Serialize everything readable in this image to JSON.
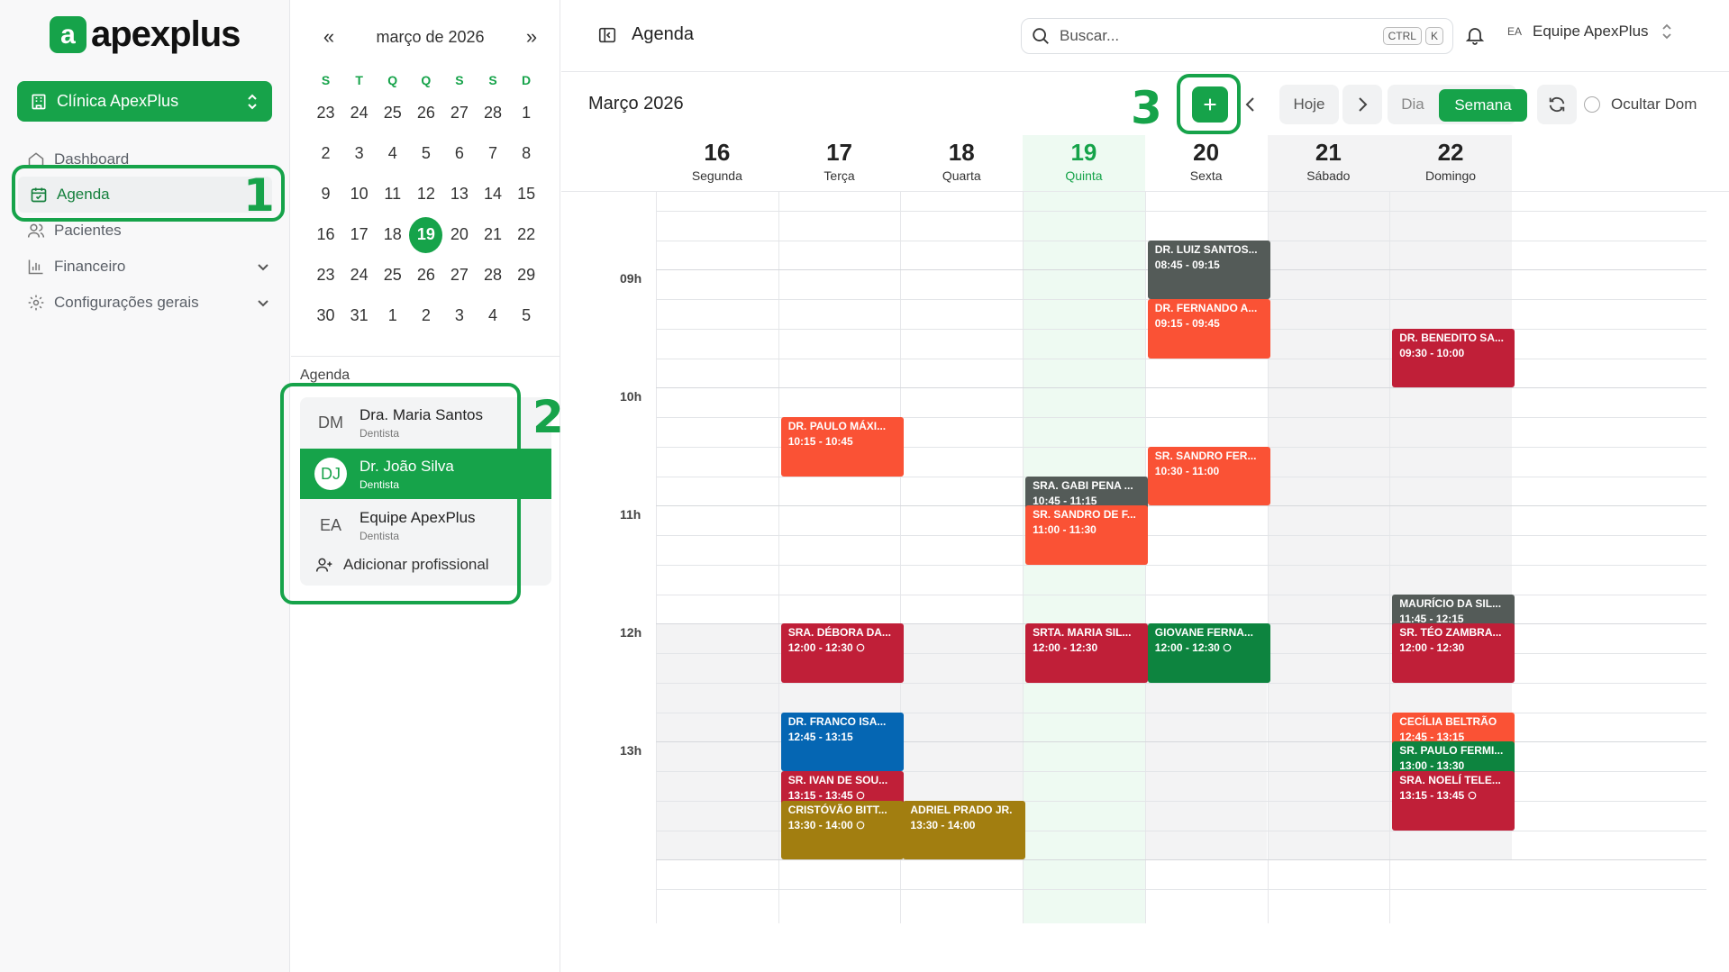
{
  "sidebar": {
    "logo_mark": "a",
    "logo_text": "apexplus",
    "clinic": "Clínica ApexPlus",
    "nav": [
      {
        "label": "Dashboard"
      },
      {
        "label": "Agenda"
      },
      {
        "label": "Pacientes"
      },
      {
        "label": "Financeiro"
      },
      {
        "label": "Configurações gerais"
      }
    ]
  },
  "annotations": {
    "one": "1",
    "two": "2",
    "three": "3"
  },
  "calendar": {
    "month": "março de 2026",
    "prev": "«",
    "next": "»",
    "weekdays": [
      "S",
      "T",
      "Q",
      "Q",
      "S",
      "S",
      "D"
    ],
    "weeks": [
      [
        "23",
        "24",
        "25",
        "26",
        "27",
        "28",
        "1"
      ],
      [
        "2",
        "3",
        "4",
        "5",
        "6",
        "7",
        "8"
      ],
      [
        "9",
        "10",
        "11",
        "12",
        "13",
        "14",
        "15"
      ],
      [
        "16",
        "17",
        "18",
        "19",
        "20",
        "21",
        "22"
      ],
      [
        "23",
        "24",
        "25",
        "26",
        "27",
        "28",
        "29"
      ],
      [
        "30",
        "31",
        "1",
        "2",
        "3",
        "4",
        "5"
      ]
    ],
    "selected": "19"
  },
  "agenda_section": {
    "label": "Agenda",
    "professionals": [
      {
        "initials": "DM",
        "name": "Dra. Maria Santos",
        "role": "Dentista",
        "active": false
      },
      {
        "initials": "DJ",
        "name": "Dr. João Silva",
        "role": "Dentista",
        "active": true
      },
      {
        "initials": "EA",
        "name": "Equipe ApexPlus",
        "role": "Dentista",
        "active": false
      }
    ],
    "add_label": "Adicionar profissional"
  },
  "topbar": {
    "title": "Agenda",
    "search_placeholder": "Buscar...",
    "kbd1": "CTRL",
    "kbd2": "K",
    "user_initials": "EA",
    "user_name": "Equipe ApexPlus"
  },
  "toolbar": {
    "month_title": "Março 2026",
    "today": "Hoje",
    "day": "Dia",
    "week": "Semana",
    "hide_sunday": "Ocultar Dom"
  },
  "week": {
    "days": [
      {
        "num": "16",
        "name": "Segunda",
        "today": false,
        "shaded": false
      },
      {
        "num": "17",
        "name": "Terça",
        "today": false,
        "shaded": false
      },
      {
        "num": "18",
        "name": "Quarta",
        "today": false,
        "shaded": false
      },
      {
        "num": "19",
        "name": "Quinta",
        "today": true,
        "shaded": false
      },
      {
        "num": "20",
        "name": "Sexta",
        "today": false,
        "shaded": false
      },
      {
        "num": "21",
        "name": "Sábado",
        "today": false,
        "shaded": true
      },
      {
        "num": "22",
        "name": "Domingo",
        "today": false,
        "shaded": true
      }
    ],
    "hours": [
      "09h",
      "10h",
      "11h",
      "12h",
      "13h"
    ]
  },
  "colors": {
    "accent": "#16a34a",
    "today_col": "#eefaf2",
    "weekend_col": "#f3f3f4",
    "gray": "#545b58",
    "orange": "#fa5235",
    "crimson": "#c01f38",
    "green": "#0d843f",
    "blue": "#0566b3",
    "olive": "#a27e10"
  },
  "events": [
    {
      "day": 4,
      "start": "08:45",
      "end": "09:15",
      "name": "DR. LUIZ SANTOS...",
      "time": "08:45 - 09:15",
      "color": "gray",
      "chat": false
    },
    {
      "day": 4,
      "start": "09:15",
      "end": "09:45",
      "name": "DR. FERNANDO A...",
      "time": "09:15 - 09:45",
      "color": "orange",
      "chat": false
    },
    {
      "day": 6,
      "start": "09:30",
      "end": "10:00",
      "name": "DR. BENEDITO SA...",
      "time": "09:30 - 10:00",
      "color": "crimson",
      "chat": false
    },
    {
      "day": 1,
      "start": "10:15",
      "end": "10:45",
      "name": "DR. PAULO MÁXI...",
      "time": "10:15 - 10:45",
      "color": "orange",
      "chat": false
    },
    {
      "day": 4,
      "start": "10:30",
      "end": "11:00",
      "name": "SR. SANDRO FER...",
      "time": "10:30 - 11:00",
      "color": "orange",
      "chat": false
    },
    {
      "day": 3,
      "start": "10:45",
      "end": "11:15",
      "name": "SRA. GABI PENA ...",
      "time": "10:45 - 11:15",
      "color": "gray",
      "chat": false
    },
    {
      "day": 3,
      "start": "11:00",
      "end": "11:30",
      "name": "SR. SANDRO DE F...",
      "time": "11:00 - 11:30",
      "color": "orange",
      "chat": false
    },
    {
      "day": 6,
      "start": "11:45",
      "end": "12:15",
      "name": "MAURÍCIO DA SIL...",
      "time": "11:45 - 12:15",
      "color": "gray",
      "chat": false
    },
    {
      "day": 1,
      "start": "12:00",
      "end": "12:30",
      "name": "SRA. DÉBORA DA...",
      "time": "12:00 - 12:30",
      "color": "crimson",
      "chat": true
    },
    {
      "day": 3,
      "start": "12:00",
      "end": "12:30",
      "name": "SRTA. MARIA SIL...",
      "time": "12:00 - 12:30",
      "color": "crimson",
      "chat": false
    },
    {
      "day": 4,
      "start": "12:00",
      "end": "12:30",
      "name": "GIOVANE FERNA...",
      "time": "12:00 - 12:30",
      "color": "green",
      "chat": true
    },
    {
      "day": 6,
      "start": "12:00",
      "end": "12:30",
      "name": "SR. TÉO ZAMBRA...",
      "time": "12:00 - 12:30",
      "color": "crimson",
      "chat": false
    },
    {
      "day": 1,
      "start": "12:45",
      "end": "13:15",
      "name": "DR. FRANCO ISA...",
      "time": "12:45 - 13:15",
      "color": "blue",
      "chat": false
    },
    {
      "day": 6,
      "start": "12:45",
      "end": "13:15",
      "name": "CECÍLIA BELTRÃO",
      "time": "12:45 - 13:15",
      "color": "orange",
      "chat": false
    },
    {
      "day": 1,
      "start": "13:15",
      "end": "13:45",
      "name": "SR. IVAN DE SOU...",
      "time": "13:15 - 13:45",
      "color": "crimson",
      "chat": true
    },
    {
      "day": 6,
      "start": "13:00",
      "end": "13:30",
      "name": "SR. PAULO FERMI...",
      "time": "13:00 - 13:30",
      "color": "green",
      "chat": false
    },
    {
      "day": 6,
      "start": "13:15",
      "end": "13:45",
      "name": "SRA. NOELÍ TELE...",
      "time": "13:15 - 13:45",
      "color": "crimson",
      "chat": true
    },
    {
      "day": 1,
      "start": "13:30",
      "end": "14:00",
      "name": "CRISTÓVÃO BITT...",
      "time": "13:30 - 14:00",
      "color": "olive",
      "chat": true
    },
    {
      "day": 2,
      "start": "13:30",
      "end": "14:00",
      "name": "ADRIEL PRADO JR.",
      "time": "13:30 - 14:00",
      "color": "olive",
      "chat": false
    }
  ]
}
